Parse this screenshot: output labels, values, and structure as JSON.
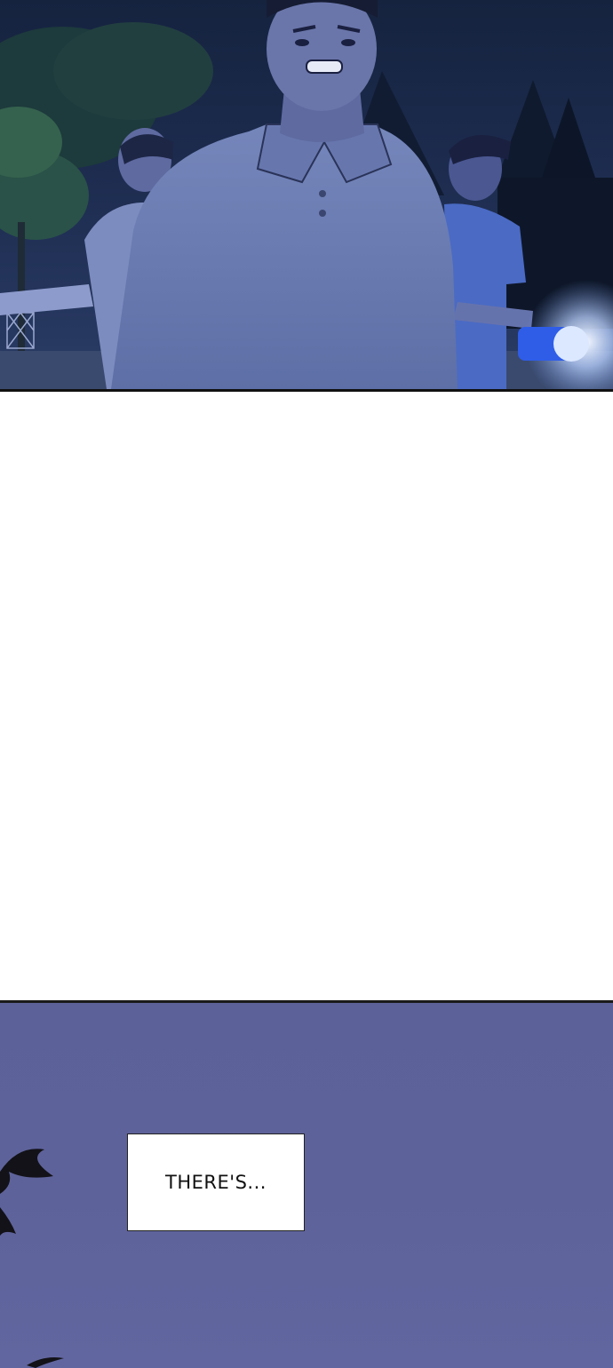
{
  "panels": {
    "top": {
      "scene": "night-forest-three-men",
      "palette": {
        "sky": "#15233f",
        "shirt": "#6d7fb6",
        "skin": "#5e6aa0",
        "flashlight": "#2f5de8",
        "glow": "#e8f1ff"
      }
    },
    "bottom": {
      "palette": {
        "sky": "#5e629a",
        "leaves": "#121218"
      },
      "caption": "THERE'S..."
    }
  }
}
